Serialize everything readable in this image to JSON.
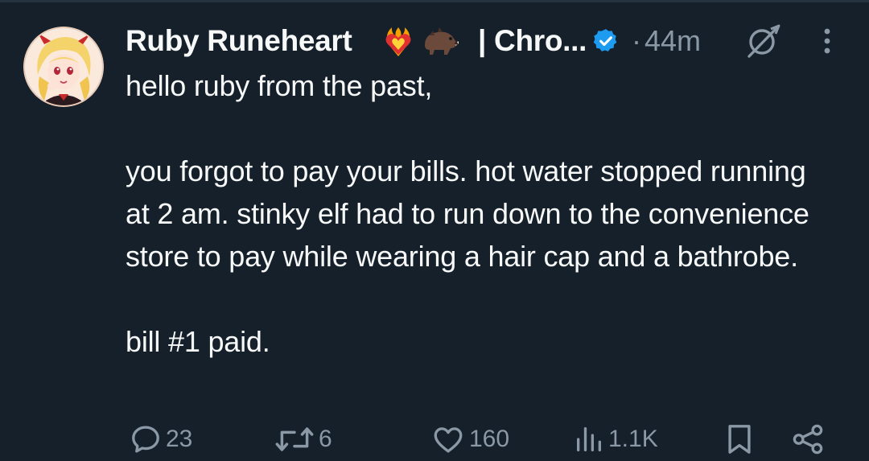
{
  "author": {
    "display_name": "Ruby Runeheart",
    "emoji_1": "heart-on-fire-emoji",
    "emoji_2": "boar-emoji",
    "name_suffix": "| Chro...",
    "verified_badge": "verified-badge-icon",
    "separator": "·",
    "timestamp": "44m"
  },
  "tweet": {
    "paragraphs": [
      "hello ruby from the past,",
      "you forgot to pay your bills. hot water stopped running at 2 am. stinky elf had to run down to the convenience store to pay while wearing a hair cap and a bathrobe.",
      "bill #1 paid."
    ]
  },
  "actions": {
    "replies": "23",
    "reposts": "6",
    "likes": "160",
    "views": "1.1K"
  },
  "colors": {
    "background": "#15202b",
    "text": "#f7f9f9",
    "muted": "#8b98a5",
    "verified": "#1d9bf0"
  }
}
